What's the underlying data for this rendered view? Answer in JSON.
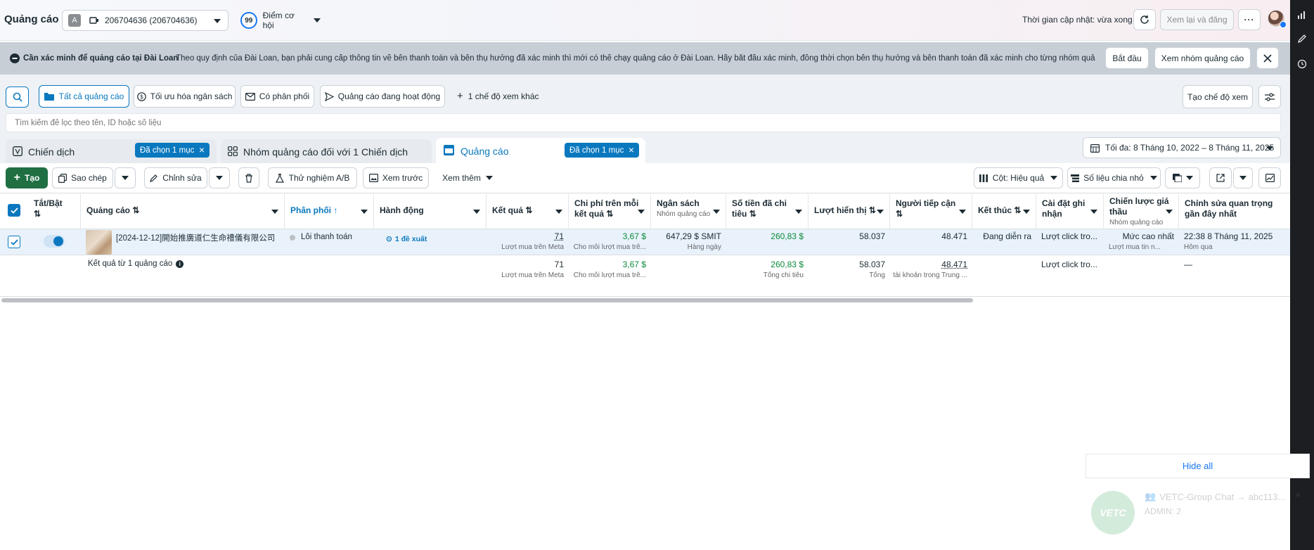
{
  "header": {
    "title": "Quảng cáo",
    "account_initial": "A",
    "account_name": "206704636 (206704636)",
    "score_value": "99",
    "score_label": "Điểm cơ hội",
    "update_time": "Thời gian cập nhật: vừa xong",
    "review_publish": "Xem lại và đăng"
  },
  "banner": {
    "title": "Cần xác minh để quảng cáo tại Đài Loan",
    "text": "Theo quy định của Đài Loan, bạn phải cung cấp thông tin về bên thanh toán và bên thụ hưởng đã xác minh thì mới có thể chạy quảng cáo ở Đài Loan. Hãy bắt đầu xác minh, đồng thời chọn bên thụ hưởng và bên thanh toán đã xác minh cho từng nhóm quảng c...",
    "start_button": "Bắt đầu",
    "view_adsets_button": "Xem nhóm quảng cáo"
  },
  "views": {
    "all_ads": "Tất cả quảng cáo",
    "budget_opt": "Tối ưu hóa ngân sách",
    "has_delivery": "Có phân phối",
    "active_ads": "Quảng cáo đang hoạt động",
    "more_views": "1 chế độ xem khác",
    "create_view": "Tạo chế độ xem"
  },
  "search": {
    "placeholder": "Tìm kiếm để lọc theo tên, ID hoặc số liệu"
  },
  "tabs": {
    "campaign": "Chiến dịch",
    "campaign_selected": "Đã chọn 1 mục",
    "adset": "Nhóm quảng cáo đối với 1 Chiến dịch",
    "ad": "Quảng cáo",
    "ad_selected": "Đã chọn 1 mục",
    "date_range": "Tối đa: 8 Tháng 10, 2022 – 8 Tháng 11, 2025"
  },
  "toolbar": {
    "create": "Tạo",
    "copy": "Sao chép",
    "edit": "Chỉnh sửa",
    "ab_test": "Thử nghiệm A/B",
    "preview": "Xem trước",
    "see_more": "Xem thêm",
    "columns": "Cột: Hiệu quả",
    "breakdown": "Số liệu chia nhỏ"
  },
  "table": {
    "headers": {
      "toggle": "Tắt/Bật",
      "ad": "Quảng cáo",
      "delivery": "Phân phối",
      "actions": "Hành động",
      "results": "Kết quả",
      "cpr": "Chi phí trên mỗi kết quả",
      "budget": "Ngân sách",
      "budget_sub": "Nhóm quảng cáo",
      "spent": "Số tiền đã chi tiêu",
      "impressions": "Lượt hiển thị",
      "reach": "Người tiếp cận",
      "ends": "Kết thúc",
      "attribution": "Cài đặt ghi nhận",
      "bid_strategy": "Chiến lược giá thầu",
      "bid_sub": "Nhóm quảng cáo",
      "last_edit": "Chỉnh sửa quan trọng gần đây nhất"
    },
    "row": {
      "name": "[2024-12-12]開始推廣道仁生命禮儀有限公司",
      "delivery": "Lỗi thanh toán",
      "actions": "1 đề xuất",
      "results": "71",
      "results_sub": "Lượt mua trên Meta",
      "cpr": "3,67 $",
      "cpr_sub": "Cho mỗi lượt mua trê...",
      "budget": "647,29 $ SMIT",
      "budget_sub": "Hàng ngày",
      "spent": "260,83 $",
      "impressions": "58.037",
      "reach": "48.471",
      "ends": "Đang diễn ra",
      "attribution": "Lượt click tro...",
      "bid": "Mức cao nhất",
      "bid_sub": "Lượt mua tin n...",
      "last_edit": "22:38 8 Tháng 11, 2025",
      "last_edit_sub": "Hôm qua"
    },
    "total": {
      "label": "Kết quả từ 1 quảng cáo",
      "results": "71",
      "results_sub": "Lượt mua trên Meta",
      "cpr": "3,67 $",
      "cpr_sub": "Cho mỗi lượt mua trê...",
      "spent": "260,83 $",
      "spent_sub": "Tổng chi tiêu",
      "impressions": "58.037",
      "impressions_sub": "Tổng",
      "reach": "48.471",
      "reach_sub": "tài khoản trong Trung ...",
      "attribution": "Lượt click tro...",
      "last_edit": "—"
    }
  },
  "notifications": {
    "hide_all": "Hide all",
    "chat_title": "VETC-Group Chat → abc113...",
    "chat_sub": "ADMIN: 2",
    "avatar_text": "VETC"
  },
  "colors": {
    "primary": "#0a78be",
    "create_green": "#1f6f43",
    "positive": "#0a8a3a"
  }
}
